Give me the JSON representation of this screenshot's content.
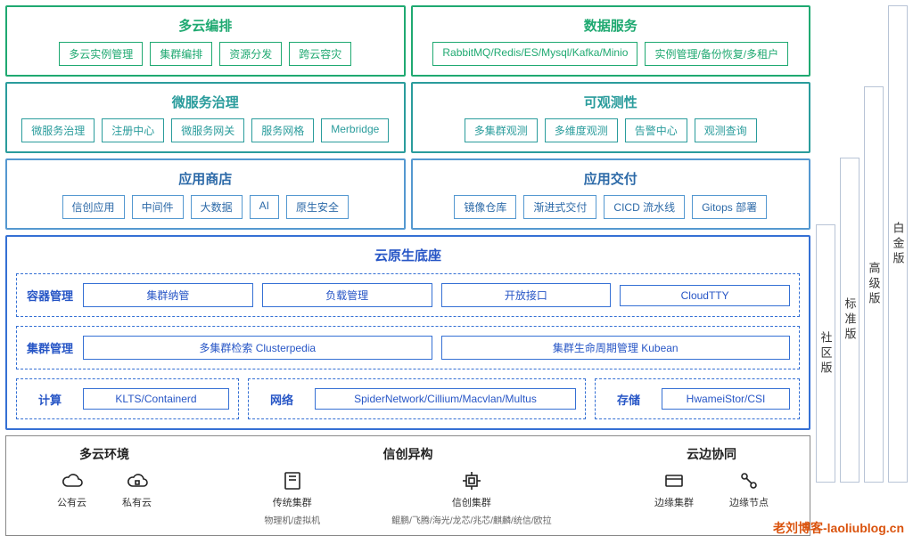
{
  "rows": {
    "multicloud_orch": {
      "title": "多云编排",
      "items": [
        "多云实例管理",
        "集群编排",
        "资源分发",
        "跨云容灾"
      ]
    },
    "data_services": {
      "title": "数据服务",
      "items": [
        "RabbitMQ/Redis/ES/Mysql/Kafka/Minio",
        "实例管理/备份恢复/多租户"
      ]
    },
    "microservice": {
      "title": "微服务治理",
      "items": [
        "微服务治理",
        "注册中心",
        "微服务网关",
        "服务网格",
        "Merbridge"
      ]
    },
    "observability": {
      "title": "可观测性",
      "items": [
        "多集群观测",
        "多维度观测",
        "告警中心",
        "观测查询"
      ]
    },
    "app_store": {
      "title": "应用商店",
      "items": [
        "信创应用",
        "中间件",
        "大数据",
        "AI",
        "原生安全"
      ]
    },
    "app_delivery": {
      "title": "应用交付",
      "items": [
        "镜像仓库",
        "渐进式交付",
        "CICD 流水线",
        "Gitops 部署"
      ]
    }
  },
  "foundation": {
    "title": "云原生底座",
    "container": {
      "label": "容器管理",
      "items": [
        "集群纳管",
        "负载管理",
        "开放接口",
        "CloudTTY"
      ]
    },
    "cluster": {
      "label": "集群管理",
      "items": [
        "多集群检索 Clusterpedia",
        "集群生命周期管理 Kubean"
      ]
    },
    "compute": {
      "label": "计算",
      "items": [
        "KLTS/Containerd"
      ]
    },
    "network": {
      "label": "网络",
      "items": [
        "SpiderNetwork/Cillium/Macvlan/Multus"
      ]
    },
    "storage": {
      "label": "存储",
      "items": [
        "HwameiStor/CSI"
      ]
    }
  },
  "infra": {
    "multicloud_env": {
      "title": "多云环境",
      "items": [
        {
          "name": "公有云",
          "sub": ""
        },
        {
          "name": "私有云",
          "sub": ""
        }
      ]
    },
    "xinchuang": {
      "title": "信创异构",
      "items": [
        {
          "name": "传统集群",
          "sub": "物理机/虚拟机"
        },
        {
          "name": "信创集群",
          "sub": "鲲鹏/飞腾/海光/龙芯/兆芯/麒麟/统信/欧拉"
        }
      ]
    },
    "edge": {
      "title": "云边协同",
      "items": [
        {
          "name": "边缘集群",
          "sub": ""
        },
        {
          "name": "边缘节点",
          "sub": ""
        }
      ]
    }
  },
  "editions": {
    "community": "社区版",
    "standard": "标准版",
    "advanced": "高级版",
    "platinum": "白金版"
  },
  "watermark": "老刘博客-laoliublog.cn"
}
